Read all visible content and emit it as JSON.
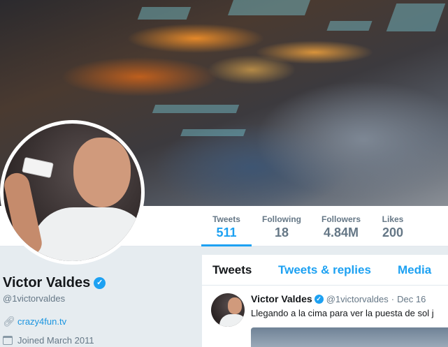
{
  "profile": {
    "name": "Victor Valdes",
    "handle": "@1victorvaldes",
    "website": "crazy4fun.tv",
    "joined": "Joined March 2011",
    "verified_icon": "verified-badge-icon"
  },
  "stats": [
    {
      "label": "Tweets",
      "value": "511",
      "active": true
    },
    {
      "label": "Following",
      "value": "18",
      "active": false
    },
    {
      "label": "Followers",
      "value": "4.84M",
      "active": false
    },
    {
      "label": "Likes",
      "value": "200",
      "active": false
    }
  ],
  "tabs": [
    {
      "label": "Tweets",
      "active": true
    },
    {
      "label": "Tweets & replies",
      "active": false
    },
    {
      "label": "Media",
      "active": false
    }
  ],
  "tweet": {
    "name": "Victor Valdes",
    "handle": "@1victorvaldes",
    "separator": "·",
    "date": "Dec 16",
    "text": "Llegando a la cima para ver la puesta de sol j"
  },
  "colors": {
    "accent": "#1da1f2",
    "link": "#1b95e0",
    "muted": "#657786",
    "background": "#e6ecf0"
  }
}
